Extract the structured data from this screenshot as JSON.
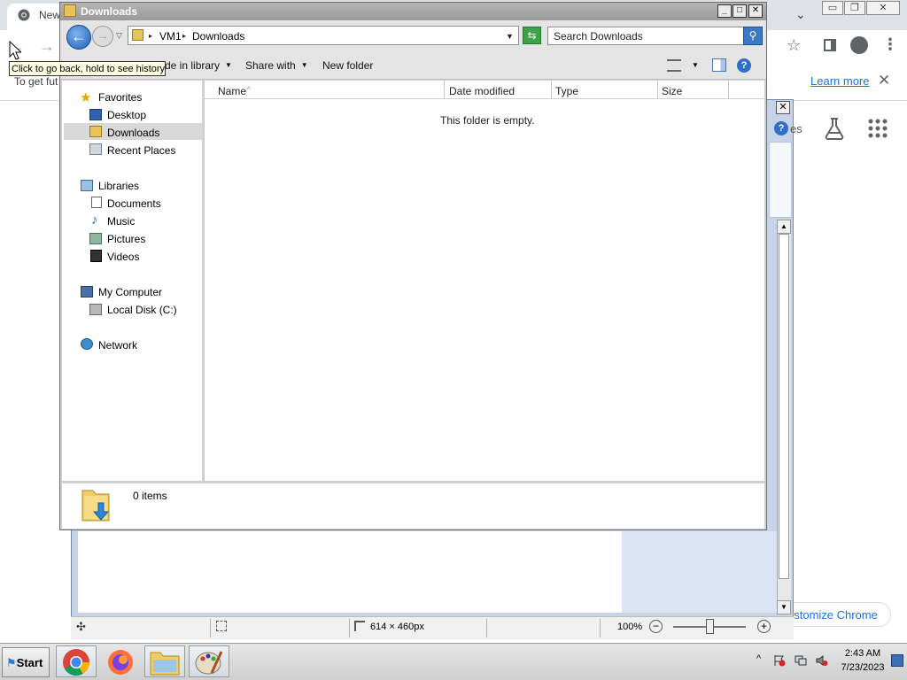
{
  "chrome": {
    "tab_label": "New",
    "info_text": "To get fut",
    "learn_more": "Learn more",
    "info_close": "✕",
    "back_glyph": "←",
    "forward_glyph": "→",
    "star_glyph": "☆",
    "kebab_glyph": "⋮",
    "dropdown_glyph": "⌄",
    "customize": "ustomize Chrome",
    "min_glyph": "▭",
    "max_glyph": "❐",
    "close_glyph": "✕"
  },
  "paint": {
    "help_glyph": "?",
    "ribbon_close": "✕",
    "partial_label": "es",
    "scroll_up": "▲",
    "scroll_down": "▼",
    "status": {
      "move_glyph": "✣",
      "canvas_size": "614 × 460px",
      "zoom": "100%",
      "zoom_minus": "−",
      "zoom_plus": "+"
    }
  },
  "explorer": {
    "title": "Downloads",
    "title_buttons": {
      "min": "_",
      "max": "□",
      "close": "✕"
    },
    "back_glyph": "←",
    "forward_glyph": "→",
    "history_glyph": "▽",
    "address": {
      "crumbs": [
        "VM1",
        "Downloads"
      ],
      "arrow": "▸",
      "drop": "▼"
    },
    "refresh_glyph": "⇆",
    "search_placeholder": "Search Downloads",
    "search_glyph": "⚲",
    "toolbar": {
      "include_in_library": "de in library",
      "share_with": "Share with",
      "new_folder": "New folder",
      "dropdown_arrow": "▼",
      "help_glyph": "?"
    },
    "nav": {
      "favorites_header": "Favorites",
      "favorites": [
        "Desktop",
        "Downloads",
        "Recent Places"
      ],
      "libraries_header": "Libraries",
      "libraries": [
        "Documents",
        "Music",
        "Pictures",
        "Videos"
      ],
      "computer_header": "My Computer",
      "computer": [
        "Local Disk (C:)"
      ],
      "network_header": "Network",
      "selected": "Downloads"
    },
    "columns": [
      "Name",
      "Date modified",
      "Type",
      "Size"
    ],
    "sort_arrow": "^",
    "empty_message": "This folder is empty.",
    "item_count": "0 items"
  },
  "tooltip": "Click to go back, hold to see history",
  "taskbar": {
    "start_label": "Start",
    "show_hidden_glyph": "^",
    "time": "2:43 AM",
    "date": "7/23/2023"
  },
  "colors": {
    "chrome_accent": "#1a73e8",
    "tooltip_bg": "#ffffe1",
    "explorer_title": "#9a9a9a",
    "nav_selected": "#d9d9d9"
  }
}
